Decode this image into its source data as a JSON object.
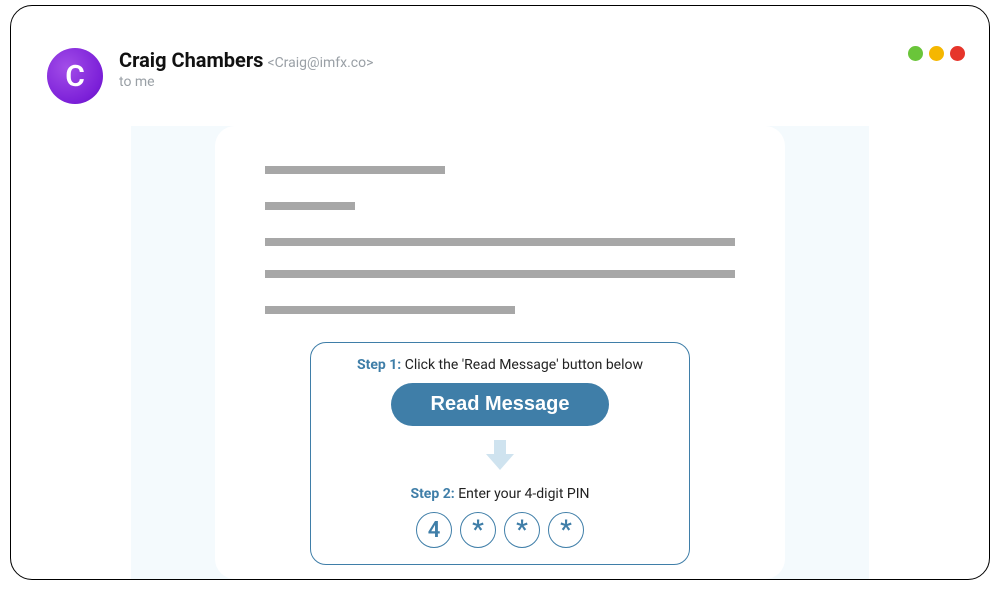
{
  "avatar": {
    "initial": "C"
  },
  "sender": {
    "name": "Craig Chambers",
    "email": "<Craig@imfx.co>"
  },
  "recipient": "to me",
  "instructions": {
    "step1_label": "Step 1:",
    "step1_text": "Click the 'Read Message' button below",
    "button_label": "Read Message",
    "step2_label": "Step 2:",
    "step2_text": "Enter your 4-digit PIN",
    "pin": [
      "4",
      "*",
      "*",
      "*"
    ]
  },
  "colors": {
    "accent": "#3f7ea8",
    "avatar_gradient_start": "#a24de8",
    "avatar_gradient_end": "#5c0fb5"
  }
}
